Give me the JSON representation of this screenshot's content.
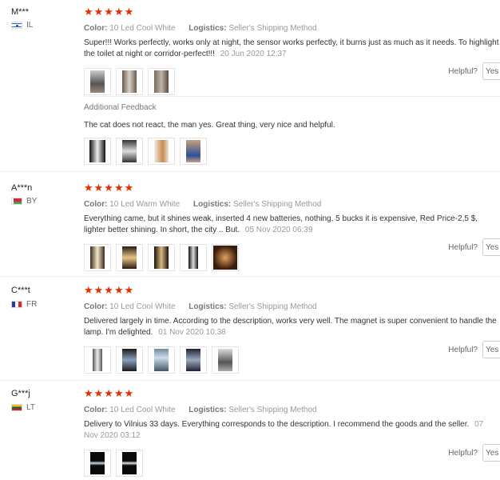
{
  "helpful_label": "Helpful?",
  "yes_label": "Yes",
  "stars": "★★★★★",
  "labels": {
    "color": "Color:",
    "logistics": "Logistics:"
  },
  "additional_feedback_label": "Additional Feedback",
  "reviews": [
    {
      "user": "M***",
      "country_code": "IL",
      "color": "10 Led Cool White",
      "logistics": "Seller's Shipping Method",
      "text": "Super!!! Works perfectly, works only at night, the sensor works perfectly, it burns just as much as it needs. To highlight the toilet at night or corridor-perfect!!!",
      "date": "20 Jun 2020 12:37",
      "additional_feedback_text": "The cat does not react, the man yes. Great thing, very nice and helpful."
    },
    {
      "user": "A***n",
      "country_code": "BY",
      "color": "10 Led Warm White",
      "logistics": "Seller's Shipping Method",
      "text": "Everything came, but it shines weak, inserted 4 new batteries, nothing, 5 bucks it is expensive, Red Price-2,5 $, lighter better shining. In short, the city .. But.",
      "date": "05 Nov 2020 06:39"
    },
    {
      "user": "C***t",
      "country_code": "FR",
      "color": "10 Led Cool White",
      "logistics": "Seller's Shipping Method",
      "text": "Delivered largely in time. According to the description, works very well. The magnet is super convenient to handle the lamp. I'm delighted.",
      "date": "01 Nov 2020 10:38"
    },
    {
      "user": "G***j",
      "country_code": "LT",
      "color": "10 Led Cool White",
      "logistics": "Seller's Shipping Method",
      "text": "Delivery to Vilnius 33 days. Everything corresponds to the description. I recommend the goods and the seller.",
      "date": "07 Nov 2020 03:12"
    }
  ]
}
